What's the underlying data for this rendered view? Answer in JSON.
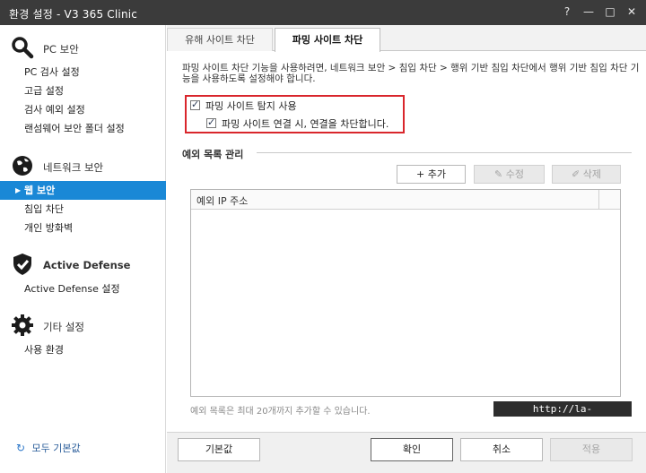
{
  "window": {
    "title": "환경 설정 - V3 365 Clinic",
    "help": "?",
    "minimize": "—",
    "maximize": "□",
    "close": "✕"
  },
  "sidebar": {
    "sections": [
      {
        "title": "PC 보안",
        "icon": "magnifier-icon",
        "items": [
          "PC 검사 설정",
          "고급 설정",
          "검사 예외 설정",
          "랜섬웨어 보안 폴더 설정"
        ]
      },
      {
        "title": "네트워크 보안",
        "icon": "globe-icon",
        "items": [
          "웹 보안",
          "침입 차단",
          "개인 방화벽"
        ]
      },
      {
        "title": "Active Defense",
        "icon": "shield-check-icon",
        "items": [
          "Active Defense 설정"
        ]
      },
      {
        "title": "기타 설정",
        "icon": "gear-icon",
        "items": [
          "사용 환경"
        ]
      }
    ],
    "active_item": "웹 보안",
    "reset_all": "모두 기본값"
  },
  "tabs": [
    "유해 사이트 차단",
    "파밍 사이트 차단"
  ],
  "active_tab": "파밍 사이트 차단",
  "description": "파밍 사이트 차단 기능을 사용하려면, 네트워크 보안 > 침입 차단 > 행위 기반 침입 차단에서 행위 기반 침입 차단 기능을 사용하도록 설정해야 합니다.",
  "options": {
    "detect_label": "파밍 사이트 탐지 사용",
    "detect_checked": true,
    "block_label": "파밍 사이트 연결 시, 연결을 차단합니다.",
    "block_checked": true
  },
  "exceptions": {
    "section_title": "예외 목록 관리",
    "add_label": "+ 추가",
    "edit_label": "✎ 수정",
    "delete_label": "✐ 삭제",
    "column_header": "예외 IP 주소",
    "rows": [],
    "note": "예외 목록은 최대 20개까지 추가할 수 있습니다."
  },
  "watermark": "http://la-nube.tistory.com",
  "footer": {
    "default_label": "기본값",
    "ok_label": "확인",
    "cancel_label": "취소",
    "apply_label": "적용"
  },
  "colors": {
    "titlebar": "#3b3b3b",
    "active_nav": "#1a88d6",
    "highlight_box": "#d9262c"
  }
}
